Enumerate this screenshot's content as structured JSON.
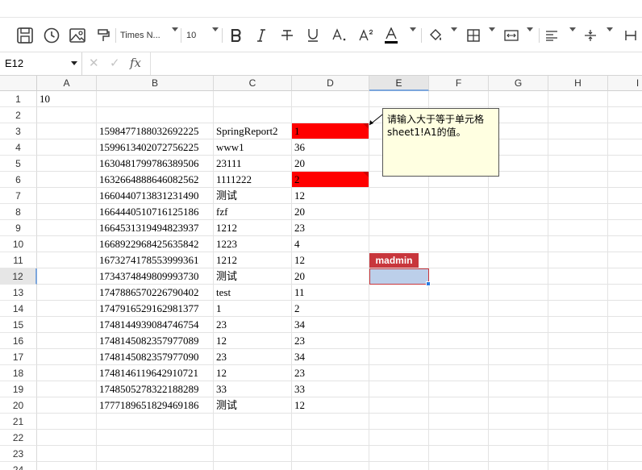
{
  "toolbar": {
    "font_name": "Times N...",
    "font_size": "10",
    "icons": [
      "save-icon",
      "history-icon",
      "image-icon",
      "format-painter-icon",
      "bold-icon",
      "italic-icon",
      "strikethrough-icon",
      "underline-icon",
      "subscript-icon",
      "superscript-icon",
      "font-color-icon",
      "fill-color-icon",
      "borders-icon",
      "merge-cells-icon",
      "align-left-icon",
      "vertical-align-icon",
      "text-wrap-icon"
    ],
    "font_color": "#000000"
  },
  "formula_bar": {
    "cell_ref": "E12",
    "cancel_icon": "✕",
    "confirm_icon": "✓",
    "fx_label": "fx",
    "formula": ""
  },
  "columns": [
    "A",
    "B",
    "C",
    "D",
    "E",
    "F",
    "G",
    "H",
    "I"
  ],
  "selected_column": "E",
  "selected_row": "12",
  "rows": [
    {
      "n": "1",
      "A": "10",
      "B": "",
      "C": "",
      "D": ""
    },
    {
      "n": "2",
      "A": "",
      "B": "",
      "C": "",
      "D": ""
    },
    {
      "n": "3",
      "A": "",
      "B": "1598477188032692225",
      "C": "SpringReport2",
      "D": "1"
    },
    {
      "n": "4",
      "A": "",
      "B": "1599613402072756225",
      "C": "www1",
      "D": "36"
    },
    {
      "n": "5",
      "A": "",
      "B": "1630481799786389506",
      "C": "23111",
      "D": "20"
    },
    {
      "n": "6",
      "A": "",
      "B": "1632664888646082562",
      "C": "1111222",
      "D": "2"
    },
    {
      "n": "7",
      "A": "",
      "B": "1660440713831231490",
      "C": "测试",
      "D": "12"
    },
    {
      "n": "8",
      "A": "",
      "B": "1664440510716125186",
      "C": "fzf",
      "D": "20"
    },
    {
      "n": "9",
      "A": "",
      "B": "1664531319494823937",
      "C": "1212",
      "D": "23"
    },
    {
      "n": "10",
      "A": "",
      "B": "1668922968425635842",
      "C": "1223",
      "D": "4"
    },
    {
      "n": "11",
      "A": "",
      "B": "1673274178553999361",
      "C": "1212",
      "D": "12"
    },
    {
      "n": "12",
      "A": "",
      "B": "1734374849809993730",
      "C": "测试",
      "D": "20"
    },
    {
      "n": "13",
      "A": "",
      "B": "1747886570226790402",
      "C": "test",
      "D": "11"
    },
    {
      "n": "14",
      "A": "",
      "B": "1747916529162981377",
      "C": "1",
      "D": "2"
    },
    {
      "n": "15",
      "A": "",
      "B": "1748144939084746754",
      "C": "23",
      "D": "34"
    },
    {
      "n": "16",
      "A": "",
      "B": "1748145082357977089",
      "C": "12",
      "D": "23"
    },
    {
      "n": "17",
      "A": "",
      "B": "1748145082357977090",
      "C": "23",
      "D": "34"
    },
    {
      "n": "18",
      "A": "",
      "B": "1748146119642910721",
      "C": "12",
      "D": "23"
    },
    {
      "n": "19",
      "A": "",
      "B": "1748505278322188289",
      "C": "33",
      "D": "33"
    },
    {
      "n": "20",
      "A": "",
      "B": "1777189651829469186",
      "C": "测试",
      "D": "12"
    },
    {
      "n": "21",
      "A": "",
      "B": "",
      "C": "",
      "D": ""
    },
    {
      "n": "22",
      "A": "",
      "B": "",
      "C": "",
      "D": ""
    },
    {
      "n": "23",
      "A": "",
      "B": "",
      "C": "",
      "D": ""
    },
    {
      "n": "24",
      "A": "",
      "B": "",
      "C": "",
      "D": ""
    }
  ],
  "highlighted_cells": [
    "D3",
    "D6"
  ],
  "highlight_color": "#ff0000",
  "comment": {
    "text": "请输入大于等于单元格sheet1!A1的值。",
    "anchor": "D3"
  },
  "collaborator": {
    "name": "madmin",
    "color": "#c8363c"
  }
}
